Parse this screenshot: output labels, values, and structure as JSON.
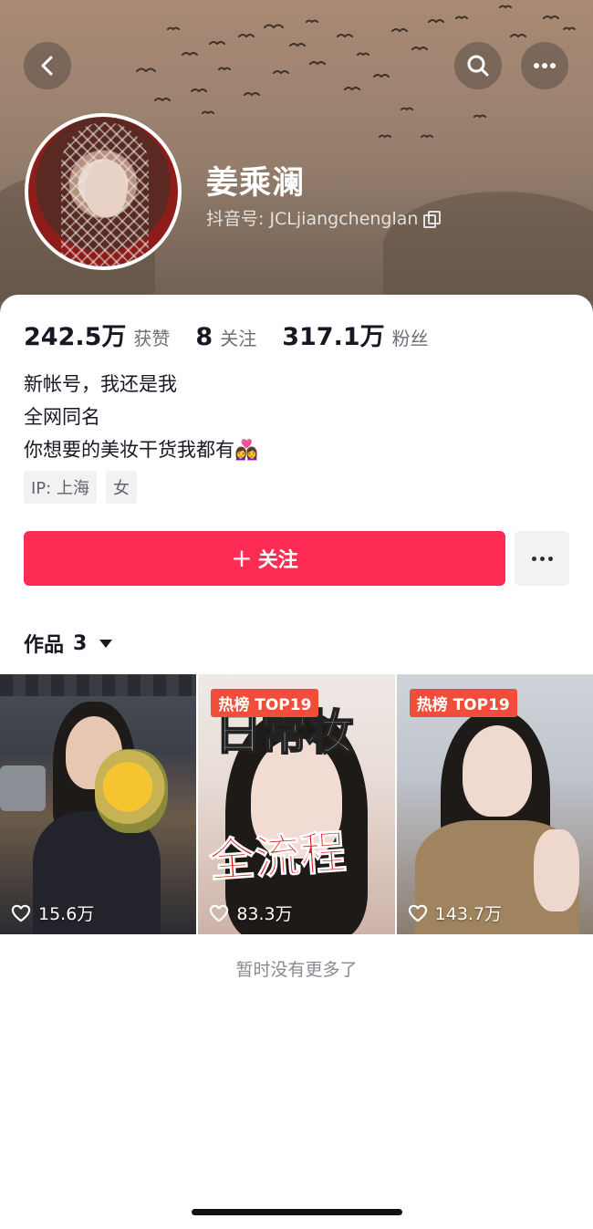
{
  "header": {
    "name": "姜乘澜",
    "douyin_id": "抖音号: JCLjiangchenglan"
  },
  "stats": {
    "likes_count": "242.5万",
    "likes_label": "获赞",
    "following_count": "8",
    "following_label": "关注",
    "followers_count": "317.1万",
    "followers_label": "粉丝"
  },
  "bio": {
    "line1": "新帐号，我还是我",
    "line2": "全网同名",
    "line3": "你想要的美妆干货我都有",
    "emoji": "👩‍❤️‍👩"
  },
  "tags": [
    "IP: 上海",
    "女"
  ],
  "actions": {
    "follow_plus": "+",
    "follow_label": "关注"
  },
  "works": {
    "tab_label": "作品",
    "tab_count": "3",
    "items": [
      {
        "badge": "",
        "overlay_top": "",
        "overlay_mid": "",
        "likes": "15.6万"
      },
      {
        "badge": "热榜 TOP19",
        "overlay_top": "日常妆",
        "overlay_mid": "全流程",
        "likes": "83.3万"
      },
      {
        "badge": "热榜 TOP19",
        "overlay_top": "",
        "overlay_mid": "",
        "likes": "143.7万"
      }
    ]
  },
  "footer": {
    "end_text": "暂时没有更多了"
  },
  "colors": {
    "accent": "#fe2c55",
    "badge": "#f04e3a"
  },
  "icons": [
    "back-arrow-icon",
    "search-icon",
    "more-icon",
    "copy-icon",
    "caret-down-icon",
    "heart-icon"
  ]
}
